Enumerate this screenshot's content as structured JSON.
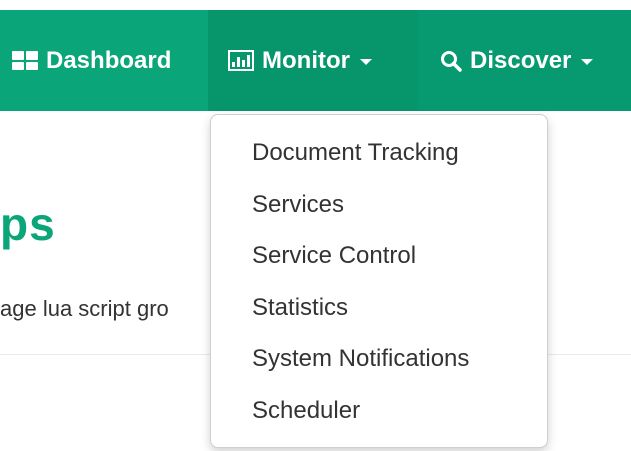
{
  "navbar": {
    "dashboard_label": "Dashboard",
    "monitor_label": "Monitor",
    "discover_label": "Discover",
    "colors": {
      "navbar_bg": "#0aa578",
      "active_bg": "#07956b",
      "text": "#ffffff"
    },
    "icons": {
      "dashboard": "grid-icon",
      "monitor": "bar-chart-icon",
      "discover": "search-icon"
    }
  },
  "monitor_menu": {
    "items": [
      {
        "label": "Document Tracking"
      },
      {
        "label": "Services"
      },
      {
        "label": "Service Control"
      },
      {
        "label": "Statistics"
      },
      {
        "label": "System Notifications"
      },
      {
        "label": "Scheduler"
      }
    ]
  },
  "page": {
    "title_fragment": "ps",
    "description_fragment": "age lua script gro"
  }
}
